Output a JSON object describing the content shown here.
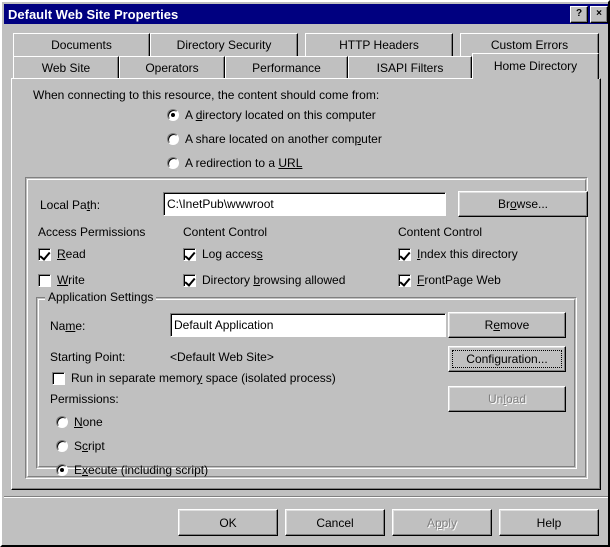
{
  "window": {
    "title": "Default Web Site Properties",
    "help_button": "?",
    "close_button": "×",
    "titlebar_color": "#000080",
    "face_color": "#c0c0c0"
  },
  "tabs": {
    "row1": [
      {
        "label": "Documents",
        "active": false
      },
      {
        "label": "Directory Security",
        "active": false
      },
      {
        "label": "HTTP Headers",
        "active": false
      },
      {
        "label": "Custom Errors",
        "active": false
      }
    ],
    "row2": [
      {
        "label": "Web Site",
        "active": false
      },
      {
        "label": "Operators",
        "active": false
      },
      {
        "label": "Performance",
        "active": false
      },
      {
        "label": "ISAPI Filters",
        "active": false
      },
      {
        "label": "Home Directory",
        "active": true
      }
    ]
  },
  "content_source": {
    "prompt": "When connecting to this resource, the content should come from:",
    "options": [
      {
        "label_pre": "A ",
        "accel": "d",
        "label_post": "irectory located on this computer",
        "selected": true
      },
      {
        "label_pre": "A share located on another com",
        "accel": "p",
        "label_post": "uter",
        "selected": false
      },
      {
        "label_pre": "A redirection to a ",
        "accel": "URL",
        "label_post": "",
        "selected": false
      }
    ]
  },
  "local_path": {
    "label_pre": "Local Pa",
    "label_accel": "t",
    "label_post": "h:",
    "value": "C:\\InetPub\\wwwroot",
    "browse_pre": "Br",
    "browse_accel": "o",
    "browse_post": "wse..."
  },
  "permissions_columns": {
    "access_permissions_heading": "Access Permissions",
    "content_control_heading_1": "Content Control",
    "content_control_heading_2": "Content Control",
    "checkboxes": [
      {
        "pre": "",
        "accel": "R",
        "post": "ead",
        "checked": true
      },
      {
        "pre": "",
        "accel": "W",
        "post": "rite",
        "checked": false
      },
      {
        "pre": "Log acces",
        "accel": "s",
        "post": "",
        "checked": true
      },
      {
        "pre": "Directory ",
        "accel": "b",
        "post": "rowsing allowed",
        "checked": true
      },
      {
        "pre": "",
        "accel": "I",
        "post": "ndex this directory",
        "checked": true
      },
      {
        "pre": "",
        "accel": "F",
        "post": "rontPage Web",
        "checked": true
      }
    ]
  },
  "application_settings": {
    "group_title": "Application Settings",
    "name_label_pre": "Na",
    "name_label_accel": "m",
    "name_label_post": "e:",
    "name_value": "Default Application",
    "starting_point_label": "Starting Point:",
    "starting_point_value": "<Default Web Site>",
    "isolated_pre": "Run in separate memor",
    "isolated_accel": "y",
    "isolated_post": " space (isolated process)",
    "isolated_checked": false,
    "permissions_label": "Permissions:",
    "permissions_radios": [
      {
        "pre": "",
        "accel": "N",
        "post": "one",
        "selected": false
      },
      {
        "pre": "S",
        "accel": "c",
        "post": "ript",
        "selected": false
      },
      {
        "pre": "E",
        "accel": "x",
        "post": "ecute (including script)",
        "selected": true
      }
    ],
    "remove_pre": "R",
    "remove_accel": "e",
    "remove_post": "move",
    "configuration_pre": "Confi",
    "configuration_accel": "g",
    "configuration_post": "uration...",
    "configuration_focused": true,
    "unload_pre": "Un",
    "unload_accel": "l",
    "unload_post": "oad",
    "unload_disabled": true
  },
  "footer": {
    "ok": "OK",
    "cancel": "Cancel",
    "apply": {
      "pre": "A",
      "accel": "p",
      "post": "ply",
      "disabled": true
    },
    "help": "Help"
  }
}
